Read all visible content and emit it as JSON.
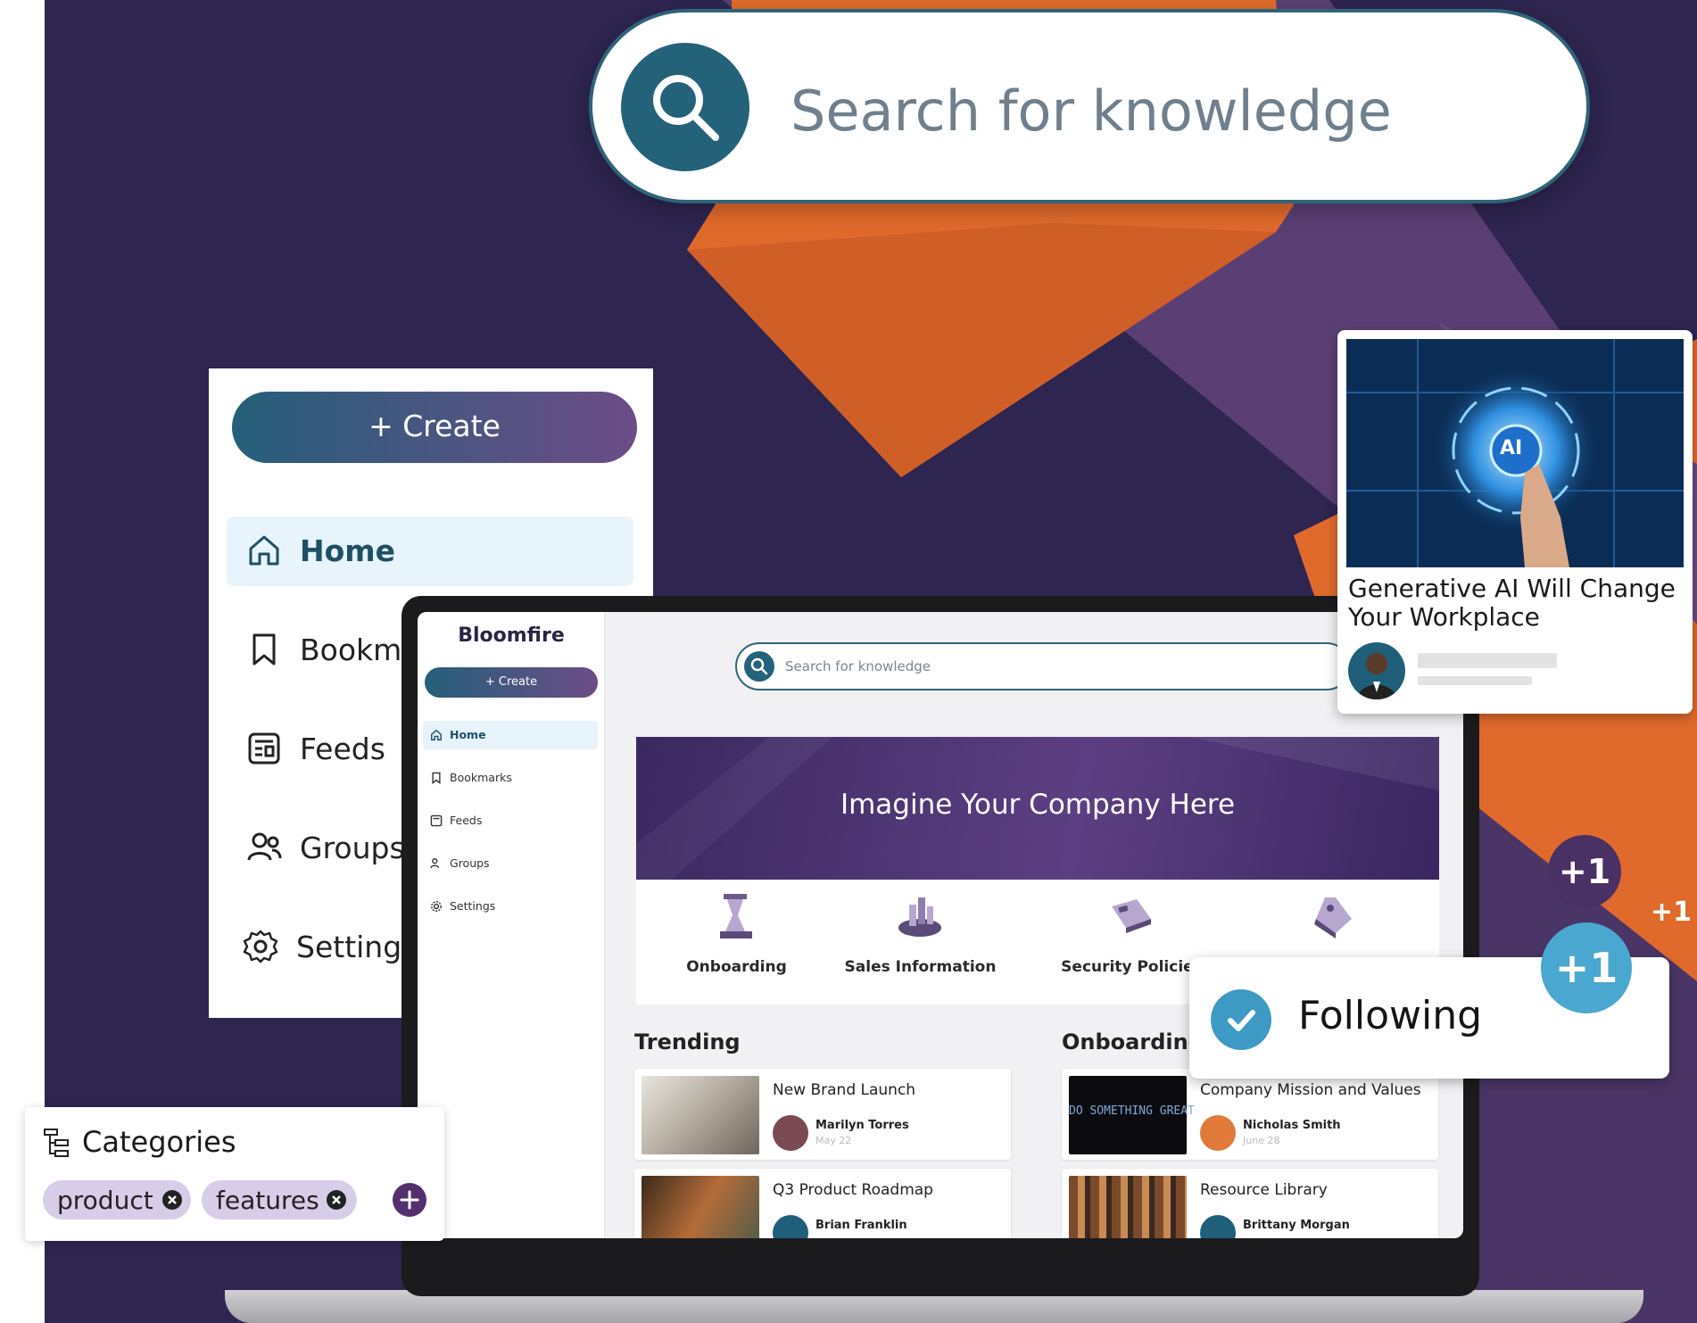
{
  "search": {
    "placeholder": "Search for knowledge"
  },
  "sidebar_large": {
    "create_label": "Create",
    "items": [
      {
        "label": "Home",
        "icon": "home-icon",
        "active": true
      },
      {
        "label": "Bookma",
        "icon": "bookmark-icon",
        "active": false
      },
      {
        "label": "Feeds",
        "icon": "feeds-icon",
        "active": false
      },
      {
        "label": "Groups",
        "icon": "groups-icon",
        "active": false
      },
      {
        "label": "Settings",
        "icon": "gear-icon",
        "active": false
      }
    ]
  },
  "app": {
    "brand": "Bloomfire",
    "create_label": "Create",
    "search_placeholder": "Search for knowledge",
    "nav": [
      {
        "label": "Home",
        "icon": "home-icon",
        "active": true
      },
      {
        "label": "Bookmarks",
        "icon": "bookmark-icon"
      },
      {
        "label": "Feeds",
        "icon": "feeds-icon"
      },
      {
        "label": "Groups",
        "icon": "groups-icon"
      },
      {
        "label": "Settings",
        "icon": "gear-icon"
      }
    ],
    "banner_title": "Imagine Your Company Here",
    "tiles": [
      {
        "label": "Onboarding",
        "icon": "hourglass-icon"
      },
      {
        "label": "Sales Information",
        "icon": "coins-icon"
      },
      {
        "label": "Security Policies",
        "icon": "keycard-icon"
      },
      {
        "label": "",
        "icon": "tag-icon"
      }
    ],
    "trending_title": "Trending",
    "onboarding_title": "Onboarding",
    "trending": [
      {
        "title": "New Brand Launch",
        "author": "Marilyn Torres",
        "date": "May 22"
      },
      {
        "title": "Q3 Product Roadmap",
        "author": "Brian Franklin",
        "date": ""
      }
    ],
    "onboarding": [
      {
        "title": "Company Mission and Values",
        "author": "Nicholas Smith",
        "date": "June 28",
        "thumb_text": "DO SOMETHING GREAT"
      },
      {
        "title": "Resource Library",
        "author": "Brittany Morgan",
        "date": ""
      }
    ]
  },
  "article": {
    "title": "Generative AI Will Change Your Workplace",
    "image_text": "AI"
  },
  "following": {
    "label": "Following",
    "badges": [
      "+1",
      "+1",
      "+1"
    ]
  },
  "categories": {
    "title": "Categories",
    "tags": [
      "product",
      "features"
    ]
  },
  "colors": {
    "background": "#2e2550",
    "accent_orange": "#e06a2c",
    "teal": "#24627a",
    "purple": "#52306e",
    "check_blue": "#3d9ac4"
  }
}
